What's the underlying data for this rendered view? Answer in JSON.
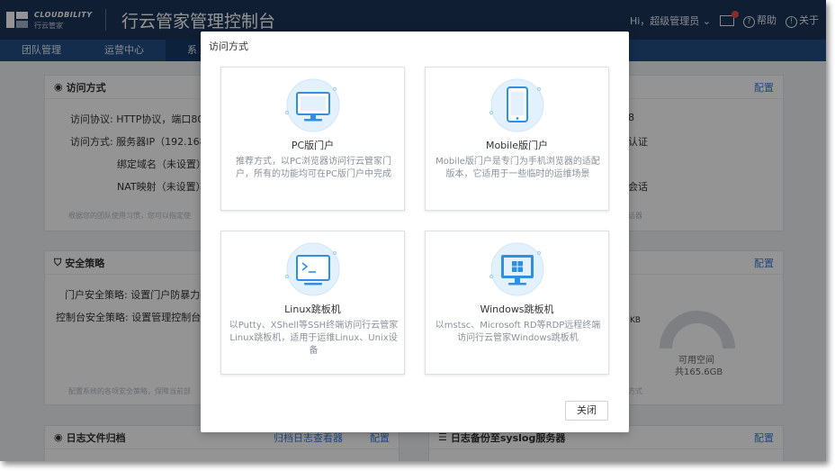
{
  "header": {
    "logo_brand": "CLOUDBILITY",
    "logo_cn": "行云管家",
    "title": "行云管家管理控制台",
    "user_menu": "Hi，超级管理员",
    "help": "帮助",
    "about": "关于"
  },
  "nav": {
    "items": [
      {
        "label": "团队管理"
      },
      {
        "label": "运营中心"
      },
      {
        "label": "系"
      }
    ]
  },
  "background": {
    "access": {
      "title": "访问方式",
      "config": "配置",
      "protocol_label": "访问协议:",
      "protocol_value": "HTTP协议，端口80",
      "method_label": "访问方式:",
      "method_value": "服务器IP（192.168.5",
      "domain_value": "绑定域名（未设置）",
      "nat_value": "NAT映射（未设置）",
      "note": "根据您的团队使用习惯，您可以指定使",
      "right_frag1": "8",
      "right_frag2": "认证",
      "right_frag3": "会话",
      "right_note": "话器"
    },
    "security": {
      "title": "安全策略",
      "config": "配置",
      "portal_label": "门户安全策略:",
      "portal_value": "设置门户防暴力破",
      "console_label": "控制台安全策略:",
      "console_value": "设置管理控制台防",
      "note": "配置系统的各项安全策略，保障当前部",
      "kb": "KB",
      "space_label": "可用空间",
      "space_value": "共165.6GB",
      "right_note": "方式"
    },
    "logs": {
      "title": "日志文件归档",
      "viewer": "归档日志查看器",
      "config": "配置",
      "syslog_title": "日志备份至syslog服务器",
      "syslog_config": "配置"
    }
  },
  "modal": {
    "title": "访问方式",
    "cards": [
      {
        "title": "PC版门户",
        "desc": "推荐方式，以PC浏览器访问行云管家门户，所有的功能均可在PC版门户中完成",
        "icon": "monitor-icon"
      },
      {
        "title": "Mobile版门户",
        "desc": "Mobile版门户是专门为手机浏览器的适配版本，它适用于一些临时的运维场景",
        "icon": "mobile-icon"
      },
      {
        "title": "Linux跳板机",
        "desc": "以Putty、XShell等SSH终端访问行云管家Linux跳板机，适用于运维Linux、Unix设备",
        "icon": "terminal-icon"
      },
      {
        "title": "Windows跳板机",
        "desc": "以mstsc、Microsoft RD等RDP远程终端访问行云管家Windows跳板机",
        "icon": "windows-icon"
      }
    ],
    "close_label": "关闭"
  },
  "colors": {
    "header_bg": "#1b3558",
    "nav_bg": "#234f86",
    "accent": "#3b7ed6",
    "icon_blue": "#2f8fe0",
    "icon_bg": "#e3f1fc"
  }
}
